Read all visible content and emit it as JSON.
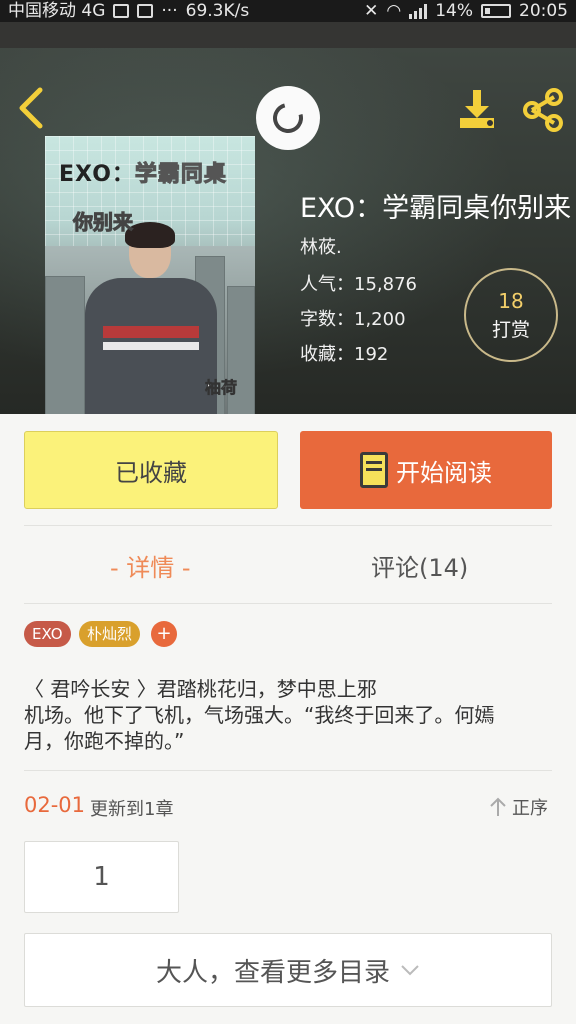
{
  "status_bar": {
    "carrier": "中国移动 4G",
    "speed": "69.3K/s",
    "battery": "14%",
    "time": "20:05",
    "more": "···"
  },
  "header": {
    "back_icon": "chevron-left-icon",
    "refresh_icon": "refresh-icon",
    "download_icon": "download-icon",
    "share_icon": "share-icon"
  },
  "cover": {
    "title_line1": "EXO：",
    "title_line1_rest": "学霸同桌",
    "title_line2": "你别来",
    "signature": "柚荷"
  },
  "book": {
    "title": "EXO：学霸同桌你别来",
    "author": "林莜.",
    "popularity": "人气：15,876",
    "words": "字数：1,200",
    "favorites": "收藏：192"
  },
  "reward": {
    "count": "18",
    "label": "打赏"
  },
  "actions": {
    "favorited_label": "已收藏",
    "read_label": "开始阅读"
  },
  "tabs": {
    "details": "- 详情 -",
    "comments": "评论(14)"
  },
  "tags": [
    "EXO",
    "朴灿烈",
    "+"
  ],
  "synopsis": {
    "line1": "〈 君吟长安 〉君踏桃花归，梦中思上邪",
    "line2": "机场。他下了飞机，气场强大。“我终于回来了。何嫣",
    "line3": "月，你跑不掉的。”"
  },
  "update": {
    "date": "02-01",
    "text": "更新到1章",
    "sort_label": "正序"
  },
  "chapter": {
    "number": "1"
  },
  "more_catalog": {
    "label": "大人，查看更多目录"
  },
  "colors": {
    "accent": "#e8693c",
    "fav_button": "#fbf27a",
    "reward_count": "#f3cf6a",
    "tag_exo": "#c65a48",
    "tag_pcy": "#d9a02c"
  }
}
